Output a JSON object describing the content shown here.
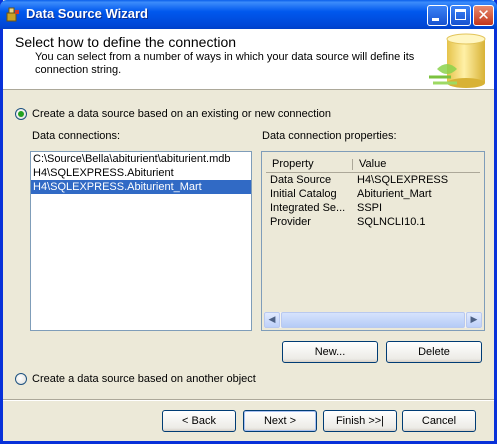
{
  "window": {
    "title": "Data Source Wizard"
  },
  "header": {
    "title": "Select how to define the connection",
    "description": "You can select from a number of ways in which your data source will define its connection string."
  },
  "options": {
    "existing_connection": {
      "label": "Create a data source based on an existing or new connection",
      "checked": true
    },
    "other_object": {
      "label": "Create a data source based on another object",
      "checked": false
    }
  },
  "data_connections": {
    "label": "Data connections:",
    "items": [
      "C:\\Source\\Bella\\abiturient\\abiturient.mdb",
      "H4\\SQLEXPRESS.Abiturient",
      "H4\\SQLEXPRESS.Abiturient_Mart"
    ],
    "selected_index": 2
  },
  "properties": {
    "label": "Data connection properties:",
    "columns": [
      "Property",
      "Value"
    ],
    "rows": [
      {
        "property": "Data Source",
        "value": "H4\\SQLEXPRESS"
      },
      {
        "property": "Initial Catalog",
        "value": "Abiturient_Mart"
      },
      {
        "property": "Integrated Se...",
        "value": "SSPI"
      },
      {
        "property": "Provider",
        "value": "SQLNCLI10.1"
      }
    ]
  },
  "buttons": {
    "new": "New...",
    "delete": "Delete",
    "back": "< Back",
    "next": "Next >",
    "finish": "Finish >>|",
    "cancel": "Cancel"
  },
  "colors": {
    "title_bar": "#0058EE",
    "selection": "#316AC5",
    "dialog_bg": "#ECE9D8"
  }
}
